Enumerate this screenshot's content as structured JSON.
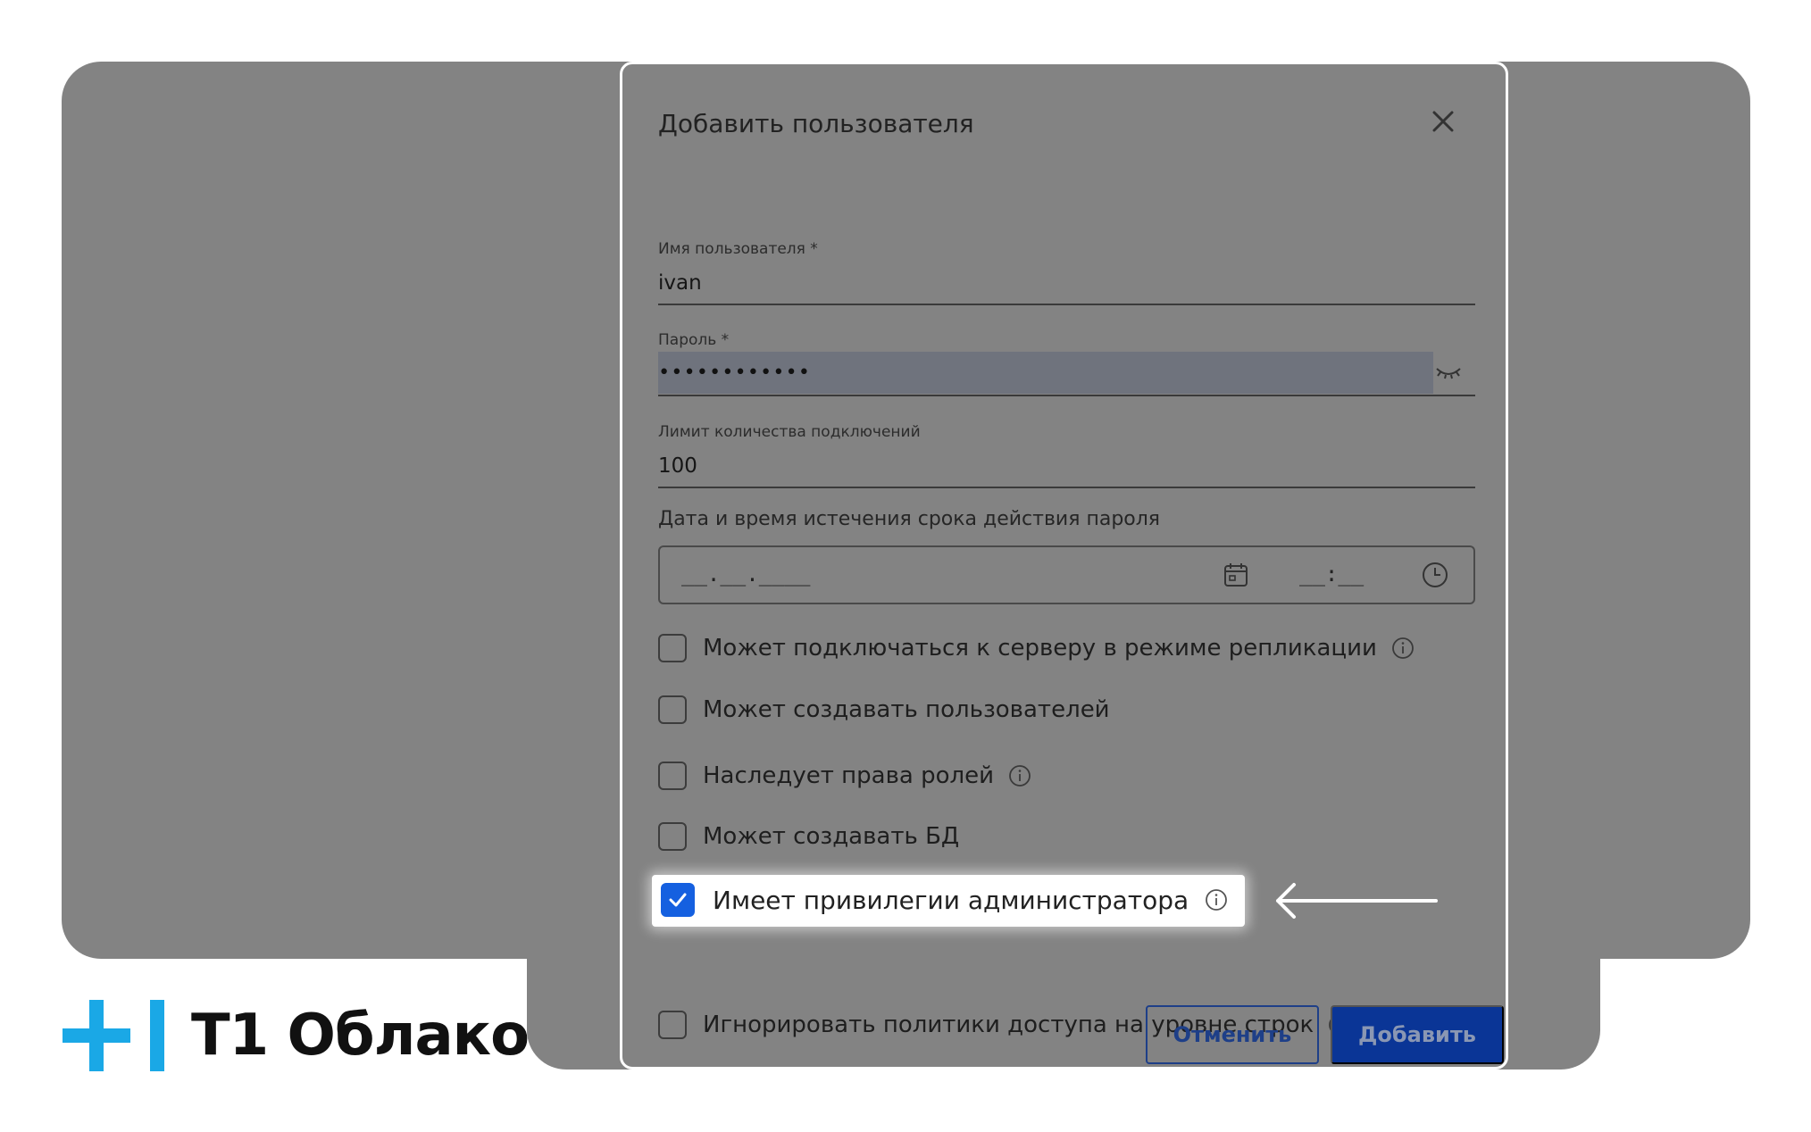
{
  "dialog": {
    "title": "Добавить пользователя",
    "fields": {
      "username": {
        "label": "Имя пользователя *",
        "value": "ivan"
      },
      "password": {
        "label": "Пароль *",
        "value": "••••••••••••"
      },
      "conn_limit": {
        "label": "Лимит количества подключений",
        "value": "100"
      }
    },
    "expiry": {
      "label": "Дата и время истечения срока действия пароля",
      "date_placeholder": "__.__.____",
      "time_placeholder": "__:__"
    },
    "checkboxes": [
      {
        "label": "Может подключаться к серверу в режиме репликации",
        "checked": false,
        "info": true
      },
      {
        "label": "Может создавать пользователей",
        "checked": false,
        "info": false
      },
      {
        "label": "Наследует права ролей",
        "checked": false,
        "info": true
      },
      {
        "label": "Может создавать БД",
        "checked": false,
        "info": false
      },
      {
        "label": "Имеет привилегии администратора",
        "checked": true,
        "info": true
      },
      {
        "label": "Игнорировать политики доступа на уровне строк",
        "checked": false,
        "info": true
      }
    ],
    "buttons": {
      "cancel": "Отменить",
      "submit": "Добавить"
    }
  },
  "brand": {
    "name": "T1 Облако",
    "accent": "#1aa8e6",
    "primary": "#0a3596"
  }
}
